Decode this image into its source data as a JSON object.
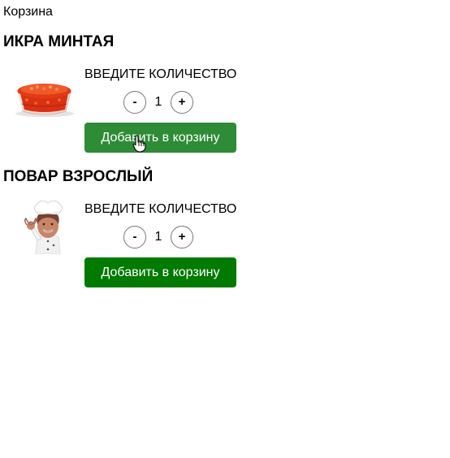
{
  "header": {
    "cart_link": "Корзина"
  },
  "products": [
    {
      "title": "ИКРА МИНТАЯ",
      "image_icon": "caviar-jar-image",
      "quantity_label": "ВВЕДИТЕ КОЛИЧЕСТВО",
      "minus_label": "-",
      "quantity": "1",
      "plus_label": "+",
      "add_label": "Добавить в корзину",
      "add_color": "#2e8b36",
      "state": "hover"
    },
    {
      "title": "ПОВАР ВЗРОСЛЫЙ",
      "image_icon": "chef-image",
      "quantity_label": "ВВЕДИТЕ КОЛИЧЕСТВО",
      "minus_label": "-",
      "quantity": "1",
      "plus_label": "+",
      "add_label": "Добавить в корзину",
      "add_color": "#007a00",
      "state": "normal"
    }
  ],
  "colors": {
    "button_text": "#ffffff",
    "page_background": "#ffffff"
  },
  "cursor_icon": "hand-pointer-icon"
}
